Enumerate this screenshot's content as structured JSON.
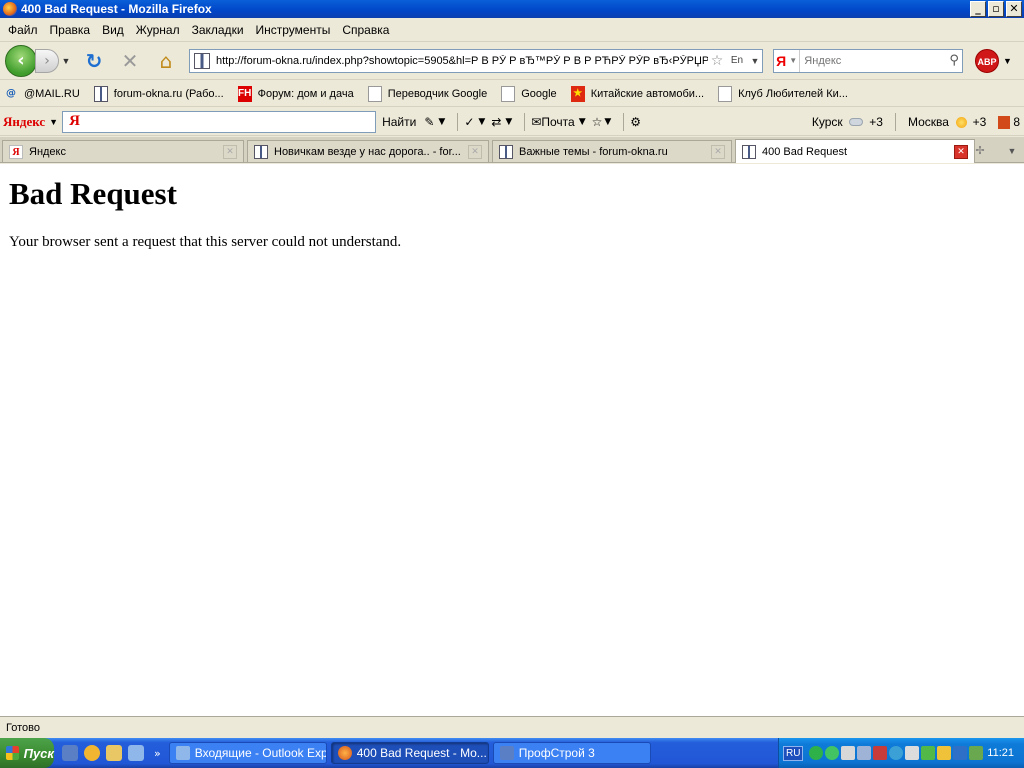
{
  "window": {
    "title": "400 Bad Request - Mozilla Firefox",
    "buttons": {
      "minimize": "_",
      "maximize": "▫",
      "close": "✕"
    }
  },
  "menu": {
    "items": [
      "Файл",
      "Правка",
      "Вид",
      "Журнал",
      "Закладки",
      "Инструменты",
      "Справка"
    ]
  },
  "nav": {
    "back_icon": "arrow-left-icon",
    "forward_icon": "arrow-right-icon",
    "url": "http://forum-okna.ru/index.php?showtopic=5905&hl=Р В РЎ Р вЂ™РЎ Р В Р РЋРЎ РЎР вЂ‹РЎРЏРЎ,РЅС,Р Ѕ",
    "search_placeholder": "Яндекс",
    "search_engine_label": "Я",
    "adblock_label": "ABP"
  },
  "bookmarks": [
    {
      "label": "@MAIL.RU",
      "icon": "mail-icon"
    },
    {
      "label": "forum-okna.ru (Рабо...",
      "icon": "forum-icon"
    },
    {
      "label": "Форум: дом и дача",
      "icon": "fh-icon"
    },
    {
      "label": "Переводчик Google",
      "icon": "page-icon"
    },
    {
      "label": "Google",
      "icon": "page-icon"
    },
    {
      "label": "Китайские автомоби...",
      "icon": "china-flag-icon"
    },
    {
      "label": "Клуб Любителей Ки...",
      "icon": "page-icon"
    }
  ],
  "yandex_bar": {
    "logo": "Яндекс",
    "input_mark": "Я",
    "find_label": "Найти",
    "mail_label": "Почта",
    "weather": [
      {
        "city": "Курск",
        "temp": "+3",
        "icon": "cloud-icon"
      },
      {
        "city": "Москва",
        "temp": "+3",
        "icon": "sun-icon"
      },
      {
        "city": "",
        "temp": "8",
        "icon": "traffic-icon"
      }
    ]
  },
  "tabs": [
    {
      "label": "Яндекс",
      "icon": "yandex-icon",
      "active": false
    },
    {
      "label": "Новичкам везде у нас дорога.. - for...",
      "icon": "forum-icon",
      "active": false
    },
    {
      "label": "Важные темы - forum-okna.ru",
      "icon": "forum-icon",
      "active": false
    },
    {
      "label": "400 Bad Request",
      "icon": "forum-icon",
      "active": true
    }
  ],
  "content": {
    "heading": "Bad Request",
    "message": "Your browser sent a request that this server could not understand."
  },
  "status": {
    "text": "Готово"
  },
  "taskbar": {
    "start_label": "Пуск",
    "tasks": [
      {
        "label": "Входящие - Outlook Exp...",
        "active": false
      },
      {
        "label": "400 Bad Request - Mo...",
        "active": true
      },
      {
        "label": "ПрофСтрой 3",
        "active": false
      }
    ],
    "lang": "RU",
    "clock": "11:21"
  },
  "colors": {
    "titlebar": "#0a5fd8",
    "taskbar": "#245edb",
    "chrome": "#ece9d8"
  }
}
